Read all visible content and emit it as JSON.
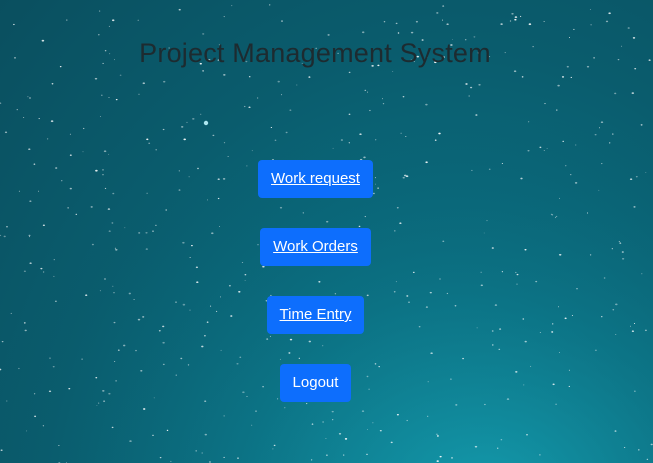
{
  "page": {
    "title": "Project Management System"
  },
  "menu": {
    "items": [
      {
        "label": "Work request"
      },
      {
        "label": "Work Orders"
      },
      {
        "label": "Time Entry"
      },
      {
        "label": "Logout"
      }
    ]
  },
  "colors": {
    "button_bg": "#0d6efd",
    "button_text": "#ffffff",
    "title_text": "#1d2b30",
    "sky_dark": "#0a4f5f",
    "sky_light": "#0f8fa3"
  }
}
